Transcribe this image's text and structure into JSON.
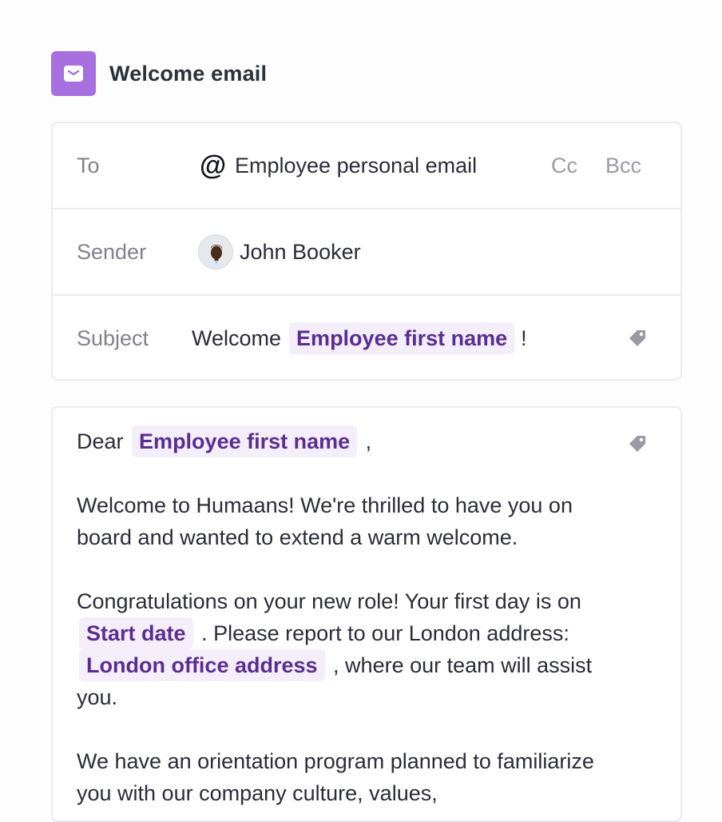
{
  "header": {
    "title": "Welcome email",
    "icon": "envelope-icon",
    "icon_color": "#a86fe0"
  },
  "fields": {
    "to": {
      "label": "To",
      "icon": "at-icon",
      "at_symbol": "@",
      "value": "Employee personal email",
      "cc_label": "Cc",
      "bcc_label": "Bcc"
    },
    "sender": {
      "label": "Sender",
      "avatar": "avatar",
      "value": "John Booker"
    },
    "subject": {
      "label": "Subject",
      "prefix": "Welcome",
      "tag": "Employee first name",
      "suffix": "!",
      "icon": "tag-icon"
    }
  },
  "body": {
    "greeting_prefix": "Dear",
    "greeting_tag": "Employee first name",
    "greeting_suffix": ",",
    "p1": "Welcome to Humaans! We're thrilled to have you on board and wanted to extend a warm welcome.",
    "p2_part1": "Congratulations on your new role! Your first day is on",
    "p2_tag1": "Start date",
    "p2_part2": ". Please report to our London address:",
    "p2_tag2": "London office address",
    "p2_part3": ", where our team will assist you.",
    "p3": "We have an orientation program planned to familiarize you with our company culture, values,",
    "icon": "tag-icon"
  },
  "colors": {
    "accent": "#a86fe0",
    "tag_bg": "#f3eef9",
    "tag_text": "#5b2d92",
    "label": "#82818f"
  }
}
